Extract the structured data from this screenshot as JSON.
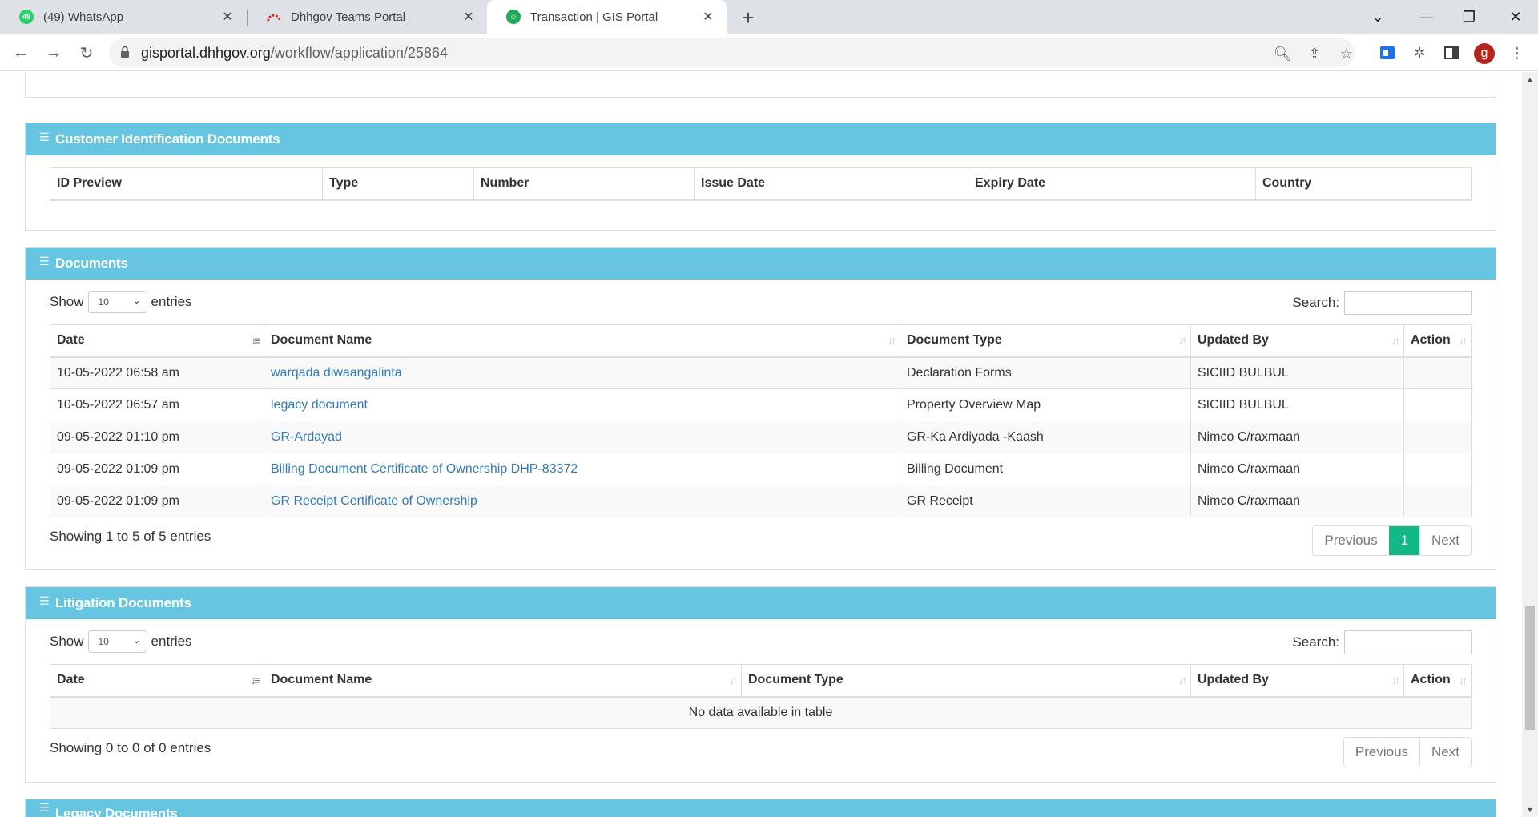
{
  "browser": {
    "tabs": [
      {
        "title": "(49) WhatsApp",
        "favicon": "whatsapp-icon",
        "badge": "49",
        "color": "#25d366"
      },
      {
        "title": "Dhhgov Teams Portal",
        "favicon": "teams-portal-icon",
        "color": "#d93025"
      },
      {
        "title": "Transaction | GIS Portal",
        "favicon": "gis-portal-icon",
        "color": "#1faa59"
      }
    ],
    "url_host": "gisportal.dhhgov.org",
    "url_path": "/workflow/application/25864",
    "profile_initial": "g"
  },
  "customer_id_docs": {
    "title": "Customer Identification Documents",
    "columns": [
      "ID Preview",
      "Type",
      "Number",
      "Issue Date",
      "Expiry Date",
      "Country"
    ]
  },
  "documents": {
    "title": "Documents",
    "show_label": "Show",
    "entries_label": "entries",
    "page_length": "10",
    "search_label": "Search:",
    "columns": [
      "Date",
      "Document Name",
      "Document Type",
      "Updated By",
      "Action"
    ],
    "rows": [
      {
        "date": "10-05-2022 06:58 am",
        "name": "warqada diwaangalinta",
        "type": "Declaration Forms",
        "updated_by": "SICIID BULBUL"
      },
      {
        "date": "10-05-2022 06:57 am",
        "name": "legacy document",
        "type": "Property Overview Map",
        "updated_by": "SICIID BULBUL"
      },
      {
        "date": "09-05-2022 01:10 pm",
        "name": "GR-Ardayad",
        "type": "GR-Ka Ardiyada -Kaash",
        "updated_by": "Nimco C/raxmaan"
      },
      {
        "date": "09-05-2022 01:09 pm",
        "name": "Billing Document Certificate of Ownership DHP-83372",
        "type": "Billing Document",
        "updated_by": "Nimco C/raxmaan"
      },
      {
        "date": "09-05-2022 01:09 pm",
        "name": "GR Receipt Certificate of Ownership",
        "type": "GR Receipt",
        "updated_by": "Nimco C/raxmaan"
      }
    ],
    "info": "Showing 1 to 5 of 5 entries",
    "pager": {
      "previous": "Previous",
      "current": "1",
      "next": "Next"
    }
  },
  "litigation": {
    "title": "Litigation Documents",
    "show_label": "Show",
    "entries_label": "entries",
    "page_length": "10",
    "search_label": "Search:",
    "columns": [
      "Date",
      "Document Name",
      "Document Type",
      "Updated By",
      "Action"
    ],
    "empty": "No data available in table",
    "info": "Showing 0 to 0 of 0 entries",
    "pager": {
      "previous": "Previous",
      "next": "Next"
    }
  },
  "legacy": {
    "title": "Legacy Documents"
  },
  "colors": {
    "panel_header": "#66c5e0",
    "link": "#337ab7",
    "active_page": "#12b886"
  }
}
